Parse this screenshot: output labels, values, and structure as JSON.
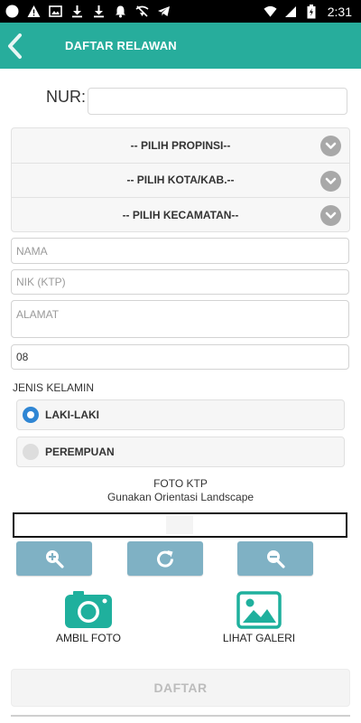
{
  "status_bar": {
    "time": "2:31",
    "icons": [
      "circle-icon",
      "warning-icon",
      "image-icon",
      "download-icon",
      "download-icon",
      "bell-icon",
      "wifi-off-icon",
      "telegram-icon",
      "wifi-icon",
      "signal-icon",
      "battery-charging-icon"
    ]
  },
  "toolbar": {
    "title": "DAFTAR RELAWAN",
    "color": "#27ad9c"
  },
  "form": {
    "nur_label": "NUR:",
    "nur_value": "",
    "selects": [
      {
        "label": "-- PILIH PROPINSI--"
      },
      {
        "label": "-- PILIH KOTA/KAB.--"
      },
      {
        "label": "-- PILIH KECAMATAN--"
      }
    ],
    "nama_placeholder": "NAMA",
    "nik_placeholder": "NIK (KTP)",
    "alamat_placeholder": "ALAMAT",
    "phone_value": "08",
    "gender_label": "JENIS KELAMIN",
    "gender_options": [
      {
        "label": "LAKI-LAKI",
        "selected": true
      },
      {
        "label": "PEREMPUAN",
        "selected": false
      }
    ],
    "radio_color": "#2f86d4"
  },
  "photo": {
    "title": "FOTO KTP",
    "hint": "Gunakan Orientasi Landscape",
    "tool_buttons": [
      "zoom-in-icon",
      "rotate-icon",
      "zoom-out-icon"
    ],
    "button_color": "#7fb1c4",
    "take_photo_label": "AMBIL FOTO",
    "gallery_label": "LIHAT GALERI"
  },
  "submit_label": "DAFTAR"
}
